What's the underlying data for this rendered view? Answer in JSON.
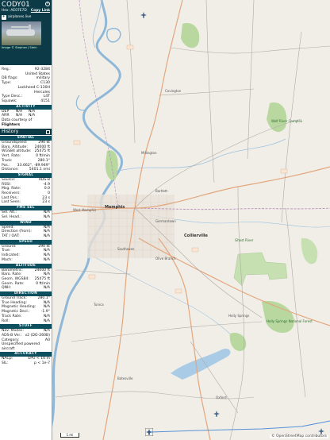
{
  "header": {
    "callsign": "CODY01",
    "hex_label": "Hex:",
    "hex_value": "AE07E7D",
    "copy_link": "Copy Link",
    "source": "airplanes.live",
    "photo_credit": "Image © Stephen J Stein"
  },
  "basic": [
    {
      "k": "Reg.:",
      "v": "92-3284"
    },
    {
      "k": "",
      "v": "United States"
    },
    {
      "k": "DB flags:",
      "v": "military"
    },
    {
      "k": "Type:",
      "v": "C130"
    },
    {
      "k": "",
      "v": "Lockheed C-130H Hercules"
    },
    {
      "k": "Type Desc.:",
      "v": "L4T"
    },
    {
      "k": "Squawk:",
      "v": "4151"
    }
  ],
  "activity": {
    "title": "ACTIVITY",
    "rows": [
      {
        "a": "DEP",
        "b": "N/A",
        "c": "N/A"
      },
      {
        "a": "ARR",
        "b": "N/A",
        "c": "N/A"
      }
    ],
    "courtesy_prefix": "Data courtesy of",
    "courtesy_name": "Flighters"
  },
  "history_label": "History",
  "sections": [
    {
      "id": "spatial",
      "title": "SPATIAL",
      "rows": [
        {
          "k": "Groundspeed:",
          "v": "290 kt"
        },
        {
          "k": "Baro. Altitude:",
          "v": "24000 ft"
        },
        {
          "k": "WGS84 altitude:",
          "v": "25475 ft"
        },
        {
          "k": "Vert. Rate:",
          "v": "0 ft/min"
        },
        {
          "k": "Track:",
          "v": "280.1°"
        },
        {
          "k": "Pos.:",
          "v": "33.662°, -89.949°"
        },
        {
          "k": "Distance:",
          "v": "5401.1 nmi"
        }
      ]
    },
    {
      "id": "signal",
      "title": "SIGNAL",
      "rows": [
        {
          "k": "Source:",
          "v": "ADS-B"
        },
        {
          "k": "RSSI:",
          "v": "-4.9"
        },
        {
          "k": "Msg. Rate:",
          "v": "0.0"
        },
        {
          "k": "Receivers:",
          "v": "0"
        },
        {
          "k": "",
          "v": ""
        },
        {
          "k": "Last Pos.:",
          "v": "23 s"
        },
        {
          "k": "Last Seen:",
          "v": "23 s"
        }
      ]
    },
    {
      "id": "fms",
      "title": "FMS SEL",
      "rows": [
        {
          "k": "Sel. Alt.:",
          "v": "N/A"
        },
        {
          "k": "Sel. Head.:",
          "v": "N/A"
        }
      ]
    },
    {
      "id": "wind",
      "title": "WIND",
      "rows": [
        {
          "k": "Speed:",
          "v": "N/A"
        },
        {
          "k": "Direction (from):",
          "v": "N/A"
        },
        {
          "k": "TAT / OAT:",
          "v": "N/A"
        }
      ]
    },
    {
      "id": "speed",
      "title": "SPEED",
      "rows": [
        {
          "k": "Ground:",
          "v": "290 kt"
        },
        {
          "k": "True:",
          "v": "N/A"
        },
        {
          "k": "Indicated:",
          "v": "N/A"
        },
        {
          "k": "Mach:",
          "v": "N/A"
        }
      ]
    },
    {
      "id": "altitude",
      "title": "ALTITUDE",
      "rows": [
        {
          "k": "Barometric:",
          "v": "24000 ft"
        },
        {
          "k": "Baro. Rate:",
          "v": "N/A"
        },
        {
          "k": "Geom. WGS84:",
          "v": "25475 ft"
        },
        {
          "k": "Geom. Rate:",
          "v": "0 ft/min"
        },
        {
          "k": "QNH:",
          "v": "N/A"
        }
      ]
    },
    {
      "id": "direction",
      "title": "DIRECTION",
      "rows": [
        {
          "k": "Ground Track:",
          "v": "280.1°"
        },
        {
          "k": "True Heading:",
          "v": "N/A"
        },
        {
          "k": "Magnetic Heading:",
          "v": "N/A"
        },
        {
          "k": "Magnetic Decl.:",
          "v": "-1.9°"
        },
        {
          "k": "Track Rate:",
          "v": "N/A"
        },
        {
          "k": "Roll:",
          "v": "N/A"
        }
      ]
    },
    {
      "id": "stuff",
      "title": "STUFF",
      "rows": [
        {
          "k": "Nav. Modes:",
          "v": "N/A"
        },
        {
          "k": "ADS-B Ver.:",
          "v": "v2 (DO-260B)"
        },
        {
          "k": "Category:",
          "v": "A0"
        }
      ]
    }
  ],
  "category_desc": "Unspecified powered aircraft",
  "accuracy": {
    "title": "ACCURACY",
    "rows": [
      {
        "k": "NACp:",
        "v": "EPU < 10 m"
      },
      {
        "k": "SIL:",
        "v": "p < 1e-7"
      }
    ]
  },
  "map": {
    "attribution": "© OpenStreetMap contributors",
    "scale": "1 mi",
    "labels": [
      {
        "t": "Memphis",
        "cls": "city"
      },
      {
        "t": "Collierville",
        "cls": "city"
      },
      {
        "t": "Southaven",
        "cls": ""
      },
      {
        "t": "Germantown",
        "cls": ""
      },
      {
        "t": "Olive Branch",
        "cls": ""
      },
      {
        "t": "Bartlett",
        "cls": ""
      },
      {
        "t": "Oxford",
        "cls": ""
      },
      {
        "t": "Batesville",
        "cls": ""
      },
      {
        "t": "Holly Springs",
        "cls": ""
      },
      {
        "t": "Tunica",
        "cls": ""
      },
      {
        "t": "West Memphis",
        "cls": ""
      },
      {
        "t": "Millington",
        "cls": ""
      },
      {
        "t": "Covington",
        "cls": ""
      },
      {
        "t": "Ghost River",
        "cls": "park"
      },
      {
        "t": "Holly Springs National Forest",
        "cls": "park"
      },
      {
        "t": "Wolf River Complex",
        "cls": "park"
      }
    ],
    "colors": {
      "river": "#8fb8d8",
      "park": "#b8d8a0",
      "major_road": "#e3a67c",
      "road": "#b0a9a2",
      "state_line": "#b388b6",
      "panel_header": "#0c3b47",
      "section_bar": "#0c4f5e"
    }
  }
}
